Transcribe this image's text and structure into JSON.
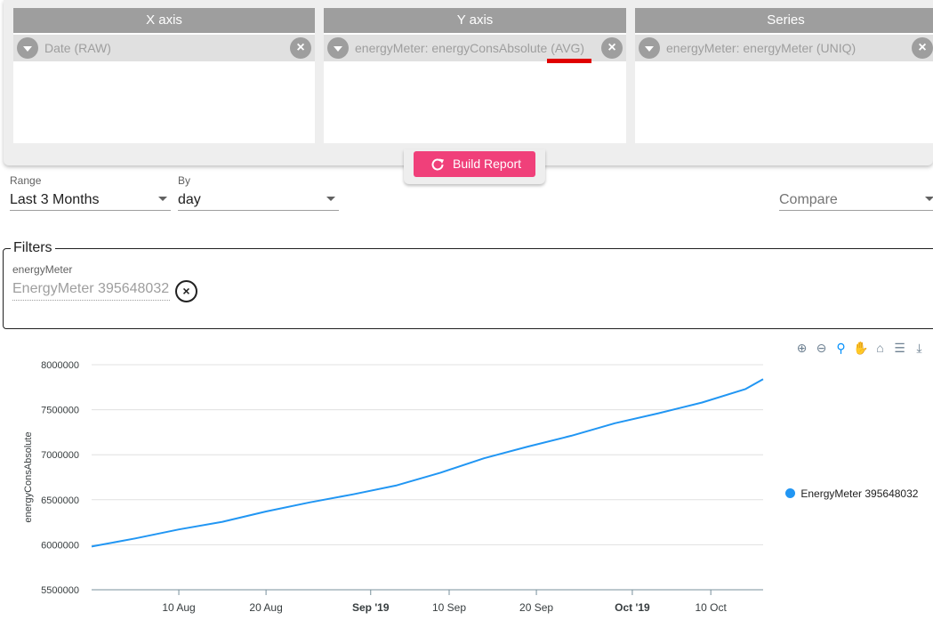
{
  "builder": {
    "x_axis": {
      "header": "X axis",
      "chip": "Date (RAW)"
    },
    "y_axis": {
      "header": "Y axis",
      "chip": "energyMeter: energyConsAbsolute (AVG)"
    },
    "series": {
      "header": "Series",
      "chip": "energyMeter: energyMeter (UNIQ)"
    },
    "build_button": "Build Report"
  },
  "range": {
    "label": "Range",
    "value": "Last 3 Months"
  },
  "by": {
    "label": "By",
    "value": "day"
  },
  "compare": {
    "placeholder": "Compare"
  },
  "filters": {
    "legend": "Filters",
    "field_label": "energyMeter",
    "field_value": "EnergyMeter 395648032"
  },
  "toolbar": {
    "icons": [
      "zoom-in-icon",
      "zoom-out-icon",
      "selection-zoom-icon",
      "pan-icon",
      "home-icon",
      "menu-icon",
      "download-icon"
    ]
  },
  "colors": {
    "accent": "#f0407a",
    "series": "#2196f3",
    "grid": "#e0e0e0",
    "highlight": "#e00000"
  },
  "chart_data": {
    "type": "line",
    "ylabel": "energyConsAbsolute",
    "xlabel": "",
    "ylim": [
      5500000,
      8000000
    ],
    "y_ticks": [
      "8000000",
      "7500000",
      "7000000",
      "6500000",
      "6000000",
      "5500000"
    ],
    "x_ticks": [
      {
        "label": "10 Aug",
        "date": "2019-08-10",
        "bold": false
      },
      {
        "label": "20 Aug",
        "date": "2019-08-20",
        "bold": false
      },
      {
        "label": "Sep '19",
        "date": "2019-09-01",
        "bold": true
      },
      {
        "label": "10 Sep",
        "date": "2019-09-10",
        "bold": false
      },
      {
        "label": "20 Sep",
        "date": "2019-09-20",
        "bold": false
      },
      {
        "label": "Oct '19",
        "date": "2019-10-01",
        "bold": true
      },
      {
        "label": "10 Oct",
        "date": "2019-10-10",
        "bold": false
      }
    ],
    "x_range": [
      "2019-07-31",
      "2019-10-16"
    ],
    "grid": true,
    "legend_position": "right",
    "series": [
      {
        "name": "EnergyMeter 395648032",
        "x": [
          "2019-07-31",
          "2019-08-05",
          "2019-08-10",
          "2019-08-15",
          "2019-08-20",
          "2019-08-25",
          "2019-08-30",
          "2019-09-04",
          "2019-09-09",
          "2019-09-14",
          "2019-09-19",
          "2019-09-24",
          "2019-09-29",
          "2019-10-04",
          "2019-10-09",
          "2019-10-14",
          "2019-10-16"
        ],
        "y": [
          5980000,
          6070000,
          6170000,
          6255000,
          6370000,
          6470000,
          6560000,
          6660000,
          6800000,
          6960000,
          7090000,
          7210000,
          7350000,
          7460000,
          7580000,
          7730000,
          7840000
        ]
      }
    ]
  }
}
